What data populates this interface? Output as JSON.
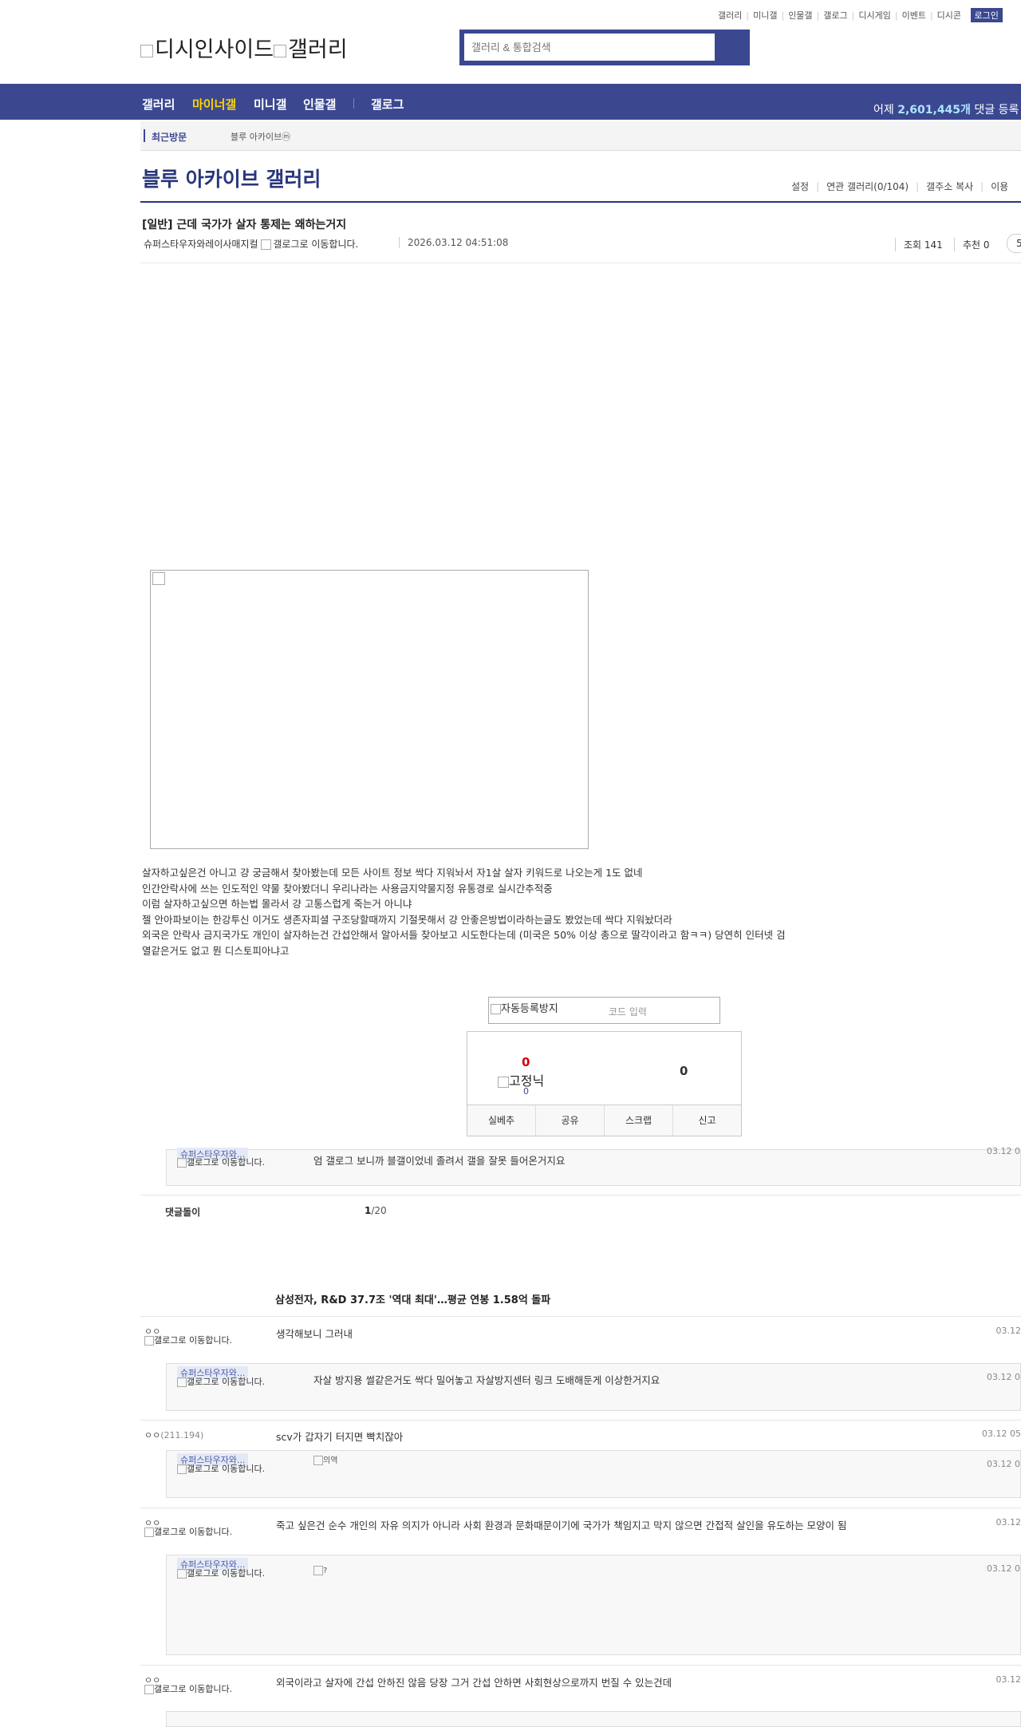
{
  "top_links": [
    "갤러리",
    "미니갤",
    "인물갤",
    "갤로그",
    "디시게임",
    "이벤트",
    "디시콘"
  ],
  "login_label": "로그인",
  "logo": {
    "site": "디시인사이드",
    "section": "갤러리"
  },
  "search": {
    "placeholder": "갤러리 & 통합검색"
  },
  "nav": {
    "items": [
      "갤러리",
      "마이너갤",
      "미니갤",
      "인물갤",
      "갤로그"
    ],
    "active": "마이너갤",
    "stats_prefix": "어제 ",
    "stats_value": "2,601,445개",
    "stats_suffix": " 댓글 등록"
  },
  "recent": {
    "label": "최근방문",
    "chip": "블루 아카이브ⓜ"
  },
  "gallery": {
    "title": "블루 아카이브 갤러리",
    "menu": [
      "설정",
      "연관 갤러리(0/104)",
      "갤주소 복사",
      "이용"
    ]
  },
  "post": {
    "title": "[일반] 근데 국가가 살자 통제는 왜하는거지",
    "author": "슈퍼스타우자와레이사매지컬",
    "author_icon_alt": "갤로그로 이동합니다.",
    "date": "2026.03.12 04:51:08",
    "views": "조회 141",
    "recommends": "추천 0",
    "comment_btn": "5",
    "body": [
      "살자하고싶은건 아니고 걍 궁금해서 찾아봤는데 모든 사이트 정보 싹다 지워놔서 자1살 살자 키워드로 나오는게 1도 없네",
      "인간안락사에 쓰는 인도적인 약물 찾아봤더니 우리나라는 사용금지약물지정 유통경로 실시간추적중",
      "이럼 살자하고싶으면 하는법 몰라서 걍 고통스럽게 죽는거 아니냐",
      "젤 안아파보이는 한강투신 이거도 생존자피셜 구조당할때까지 기절못해서 걍 안좋은방법이라하는글도 봤었는데 싹다 지워놨더라",
      "외국은 안락사 금지국가도 개인이 살자하는건 간섭안해서 알아서들 찾아보고 시도한다는데 (미국은 50% 이상 총으로 딸각이라고 함ㅋㅋ) 당연히 인터넷 검",
      "열같은거도 없고 뭔 디스토피아냐고"
    ]
  },
  "captcha": {
    "img_alt": "자동등록방지",
    "placeholder": "코드 입력"
  },
  "recommend_box": {
    "up": "0",
    "fixed_label": "고정닉",
    "fixed_count": "0",
    "down": "0",
    "actions": [
      "실베추",
      "공유",
      "스크랩",
      "신고"
    ]
  },
  "comments_section": {
    "label": "댓글돌이",
    "page_current": "1",
    "page_total": "/20"
  },
  "news_headline": "삼성전자, R&D 37.7조 '역대 최대'…평균 연봉 1.58억 돌파",
  "comments": [
    {
      "nick": "ㅇㅇ",
      "ip": "",
      "icon_alt": "갤로그로 이동합니다.",
      "text": "생각해보니 그러내",
      "date": "03.12",
      "reply": {
        "nick": "슈퍼스타우자와...",
        "icon_alt": "갤로그로 이동합니다.",
        "text": "자살 방지용 썰같은거도 싹다 밀어놓고 자살방지센터 링크 도배해둔게 이상한거지요",
        "date": "03.12 0"
      }
    },
    {
      "nick": "ㅇㅇ",
      "ip": "(211.194)",
      "icon_alt": "",
      "text": "scv가 갑자기 터지면 빡치잖아",
      "date": "03.12 05",
      "reply": {
        "nick": "슈퍼스타우자와...",
        "icon_alt": "갤로그로 이동합니다.",
        "text": "",
        "dccon_alt": "의역",
        "date": "03.12 0"
      }
    },
    {
      "nick": "ㅇㅇ",
      "ip": "",
      "icon_alt": "갤로그로 이동합니다.",
      "text": "죽고 싶은건 순수 개인의 자유 의지가 아니라 사회 환경과 문화때문이기에 국가가 책임지고 막지 않으면 간접적 살인을 유도하는 모양이 됨",
      "date": "03.12",
      "reply": {
        "nick": "슈퍼스타우자와...",
        "icon_alt": "갤로그로 이동합니다.",
        "text": "",
        "dccon_alt": "?",
        "date": "03.12 0"
      }
    },
    {
      "nick": "ㅇㅇ",
      "ip": "",
      "icon_alt": "갤로그로 이동합니다.",
      "text": "외국이라고 살자에 간섭 안하진 않음 당장 그거 간섭 안하면 사회현상으로까지 번질 수 있는건데",
      "date": "03.12"
    }
  ],
  "top_reply": {
    "nick": "슈퍼스타우자와...",
    "icon_alt": "갤로그로 이동합니다.",
    "text": "엄 갤로그 보니까 블갤이었네 졸려서 갤을 잘못 들어온거지요",
    "date": "03.12 0"
  }
}
